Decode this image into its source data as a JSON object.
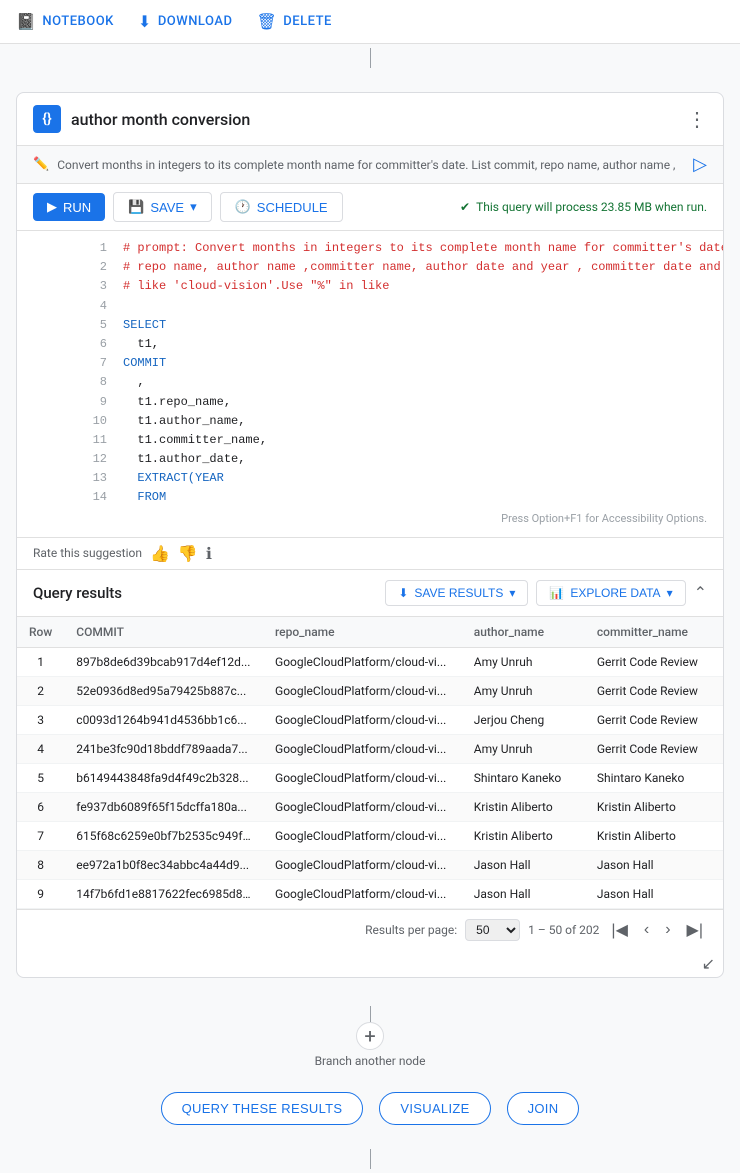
{
  "toolbar": {
    "notebook_label": "NOTEBOOK",
    "download_label": "DOWNLOAD",
    "delete_label": "DELETE"
  },
  "card": {
    "title": "author month conversion",
    "icon_text": "{}",
    "description": "Convert months in integers to its complete month name for committer's date. List commit, repo name, author name ,"
  },
  "action_bar": {
    "run_label": "RUN",
    "save_label": "SAVE",
    "schedule_label": "SCHEDULE",
    "query_info": "This query will process 23.85 MB when run."
  },
  "code": {
    "lines": [
      {
        "num": "1",
        "text": "# prompt: Convert months in integers to its complete month name for committer's date.List commit,",
        "type": "comment"
      },
      {
        "num": "2",
        "text": "# repo name, author name ,committer name, author date and year , committer date and  year  for repo",
        "type": "comment"
      },
      {
        "num": "3",
        "text": "# like 'cloud-vision'.Use \"%\" in like",
        "type": "comment"
      },
      {
        "num": "4",
        "text": "",
        "type": "default"
      },
      {
        "num": "5",
        "text": "SELECT",
        "type": "keyword"
      },
      {
        "num": "6",
        "text": "  t1,",
        "type": "default"
      },
      {
        "num": "7",
        "text": "COMMIT",
        "type": "keyword"
      },
      {
        "num": "8",
        "text": "  ,",
        "type": "default"
      },
      {
        "num": "9",
        "text": "  t1.repo_name,",
        "type": "default"
      },
      {
        "num": "10",
        "text": "  t1.author_name,",
        "type": "default"
      },
      {
        "num": "11",
        "text": "  t1.committer_name,",
        "type": "default"
      },
      {
        "num": "12",
        "text": "  t1.author_date,",
        "type": "default"
      },
      {
        "num": "13",
        "text": "  EXTRACT(YEAR",
        "type": "keyword"
      },
      {
        "num": "14",
        "text": "  FROM",
        "type": "keyword"
      }
    ],
    "accessibility_hint": "Press Option+F1 for Accessibility Options."
  },
  "rating": {
    "label": "Rate this suggestion"
  },
  "results": {
    "title": "Query results",
    "save_results_label": "SAVE RESULTS",
    "explore_data_label": "EXPLORE DATA",
    "columns": [
      "Row",
      "COMMIT",
      "repo_name",
      "author_name",
      "committer_name"
    ],
    "rows": [
      {
        "row": "1",
        "commit": "897b8de6d39bcab917d4ef12d...",
        "repo": "GoogleCloudPlatform/cloud-vi...",
        "author": "Amy Unruh",
        "committer": "Gerrit Code Review"
      },
      {
        "row": "2",
        "commit": "52e0936d8ed95a79425b887c...",
        "repo": "GoogleCloudPlatform/cloud-vi...",
        "author": "Amy Unruh",
        "committer": "Gerrit Code Review"
      },
      {
        "row": "3",
        "commit": "c0093d1264b941d4536bb1c6...",
        "repo": "GoogleCloudPlatform/cloud-vi...",
        "author": "Jerjou Cheng",
        "committer": "Gerrit Code Review"
      },
      {
        "row": "4",
        "commit": "241be3fc90d18bddf789aada7...",
        "repo": "GoogleCloudPlatform/cloud-vi...",
        "author": "Amy Unruh",
        "committer": "Gerrit Code Review"
      },
      {
        "row": "5",
        "commit": "b6149443848fa9d4f49c2b328...",
        "repo": "GoogleCloudPlatform/cloud-vi...",
        "author": "Shintaro Kaneko",
        "committer": "Shintaro Kaneko"
      },
      {
        "row": "6",
        "commit": "fe937db6089f65f15dcffa180a...",
        "repo": "GoogleCloudPlatform/cloud-vi...",
        "author": "Kristin Aliberto",
        "committer": "Kristin Aliberto"
      },
      {
        "row": "7",
        "commit": "615f68c6259e0bf7b2535c949f...",
        "repo": "GoogleCloudPlatform/cloud-vi...",
        "author": "Kristin Aliberto",
        "committer": "Kristin Aliberto"
      },
      {
        "row": "8",
        "commit": "ee972a1b0f8ec34abbc4a44d9...",
        "repo": "GoogleCloudPlatform/cloud-vi...",
        "author": "Jason Hall",
        "committer": "Jason Hall"
      },
      {
        "row": "9",
        "commit": "14f7b6fd1e8817622fec6985d8...",
        "repo": "GoogleCloudPlatform/cloud-vi...",
        "author": "Jason Hall",
        "committer": "Jason Hall"
      }
    ],
    "pagination": {
      "per_page_label": "Results per page:",
      "per_page_value": "50",
      "range": "1 – 50 of 202"
    }
  },
  "branch": {
    "label": "Branch another node",
    "add_icon": "+"
  },
  "bottom_actions": {
    "query_these_results_label": "QUERY THESE RESULTS",
    "visualize_label": "VISUALIZE",
    "join_label": "JOIN"
  }
}
